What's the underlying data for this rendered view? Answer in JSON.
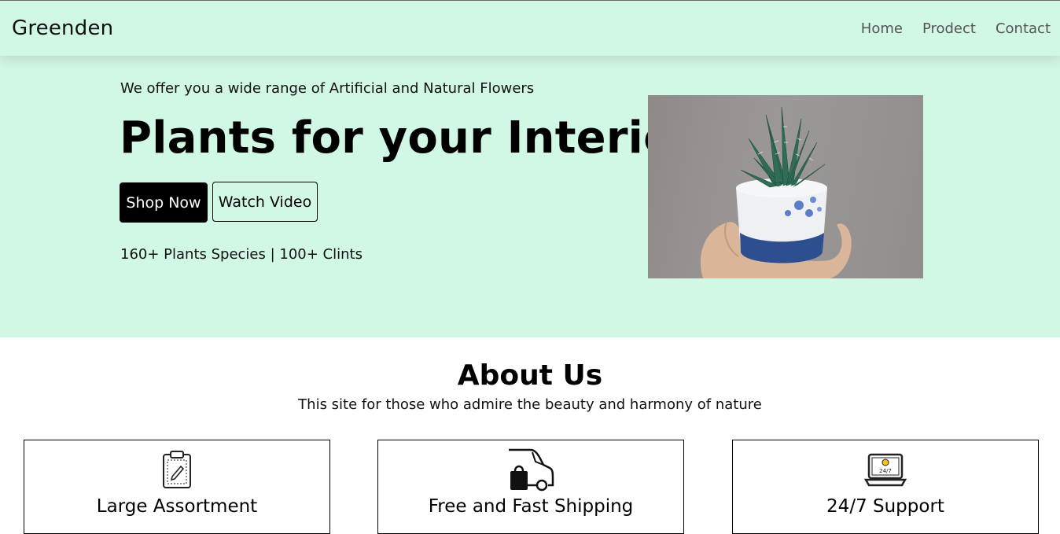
{
  "navbar": {
    "brand": "Greenden",
    "links": [
      {
        "label": "Home"
      },
      {
        "label": "Prodect"
      },
      {
        "label": "Contact"
      }
    ]
  },
  "hero": {
    "tagline": "We offer you a wide range of Artificial and Natural Flowers",
    "title": "Plants for your Interior",
    "shop_button": "Shop Now",
    "watch_button": "Watch Video",
    "stats": "160+ Plants Species | 100+ Clints",
    "image_icon": "succulent-plant-photo"
  },
  "about": {
    "title": "About Us",
    "subtitle": "This site for those who admire the beauty and harmony of nature",
    "cards": [
      {
        "title": "Large Assortment",
        "icon": "clipboard-pencil-icon"
      },
      {
        "title": "Free and Fast Shipping",
        "icon": "delivery-truck-bag-icon"
      },
      {
        "title": "24/7 Support",
        "icon": "support-laptop-icon"
      }
    ]
  },
  "colors": {
    "mint": "#d1f8e4",
    "black": "#000000",
    "nav_link": "#555555"
  }
}
